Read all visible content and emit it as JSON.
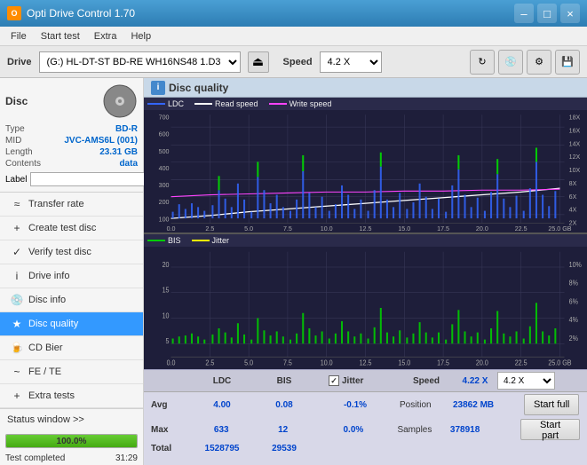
{
  "titleBar": {
    "title": "Opti Drive Control 1.70",
    "minimize": "–",
    "maximize": "□",
    "close": "×"
  },
  "menuBar": {
    "items": [
      "File",
      "Start test",
      "Extra",
      "Help"
    ]
  },
  "driveBar": {
    "label": "Drive",
    "driveValue": "(G:)  HL-DT-ST BD-RE  WH16NS48 1.D3",
    "speedLabel": "Speed",
    "speedValue": "4.2 X"
  },
  "disc": {
    "title": "Disc",
    "type": {
      "label": "Type",
      "value": "BD-R"
    },
    "mid": {
      "label": "MID",
      "value": "JVC-AMS6L (001)"
    },
    "length": {
      "label": "Length",
      "value": "23.31 GB"
    },
    "contents": {
      "label": "Contents",
      "value": "data"
    },
    "labelField": {
      "label": "Label",
      "placeholder": ""
    }
  },
  "nav": {
    "items": [
      {
        "id": "transfer-rate",
        "label": "Transfer rate",
        "icon": "≈"
      },
      {
        "id": "create-test-disc",
        "label": "Create test disc",
        "icon": "+"
      },
      {
        "id": "verify-test-disc",
        "label": "Verify test disc",
        "icon": "✓"
      },
      {
        "id": "drive-info",
        "label": "Drive info",
        "icon": "i"
      },
      {
        "id": "disc-info",
        "label": "Disc info",
        "icon": "📀"
      },
      {
        "id": "disc-quality",
        "label": "Disc quality",
        "icon": "★",
        "active": true
      },
      {
        "id": "cd-bier",
        "label": "CD Bier",
        "icon": "🍺"
      },
      {
        "id": "fe-te",
        "label": "FE / TE",
        "icon": "~"
      },
      {
        "id": "extra-tests",
        "label": "Extra tests",
        "icon": "+"
      }
    ]
  },
  "statusWindow": {
    "label": "Status window >>",
    "progressPercent": "100.0%",
    "progressWidth": 100,
    "completedText": "Test completed",
    "time": "31:29"
  },
  "discQuality": {
    "title": "Disc quality",
    "iconLabel": "i",
    "chart1": {
      "legend": [
        {
          "label": "LDC",
          "color": "#3366ff"
        },
        {
          "label": "Read speed",
          "color": "#ffffff"
        },
        {
          "label": "Write speed",
          "color": "#ff44ff"
        }
      ],
      "yAxisLeft": [
        "700",
        "600",
        "500",
        "400",
        "300",
        "200",
        "100"
      ],
      "yAxisRight": [
        "18X",
        "16X",
        "14X",
        "12X",
        "10X",
        "8X",
        "6X",
        "4X",
        "2X"
      ],
      "xAxis": [
        "0.0",
        "2.5",
        "5.0",
        "7.5",
        "10.0",
        "12.5",
        "15.0",
        "17.5",
        "20.0",
        "22.5",
        "25.0 GB"
      ]
    },
    "chart2": {
      "legend": [
        {
          "label": "BIS",
          "color": "#00cc00"
        },
        {
          "label": "Jitter",
          "color": "#ffff00"
        }
      ],
      "yAxisLeft": [
        "20",
        "15",
        "10",
        "5"
      ],
      "yAxisRight": [
        "10%",
        "8%",
        "6%",
        "4%",
        "2%"
      ],
      "xAxis": [
        "0.0",
        "2.5",
        "5.0",
        "7.5",
        "10.0",
        "12.5",
        "15.0",
        "17.5",
        "20.0",
        "22.5",
        "25.0 GB"
      ]
    },
    "stats": {
      "headers": [
        "",
        "LDC",
        "BIS",
        "",
        "Jitter",
        "Speed",
        ""
      ],
      "avg": {
        "label": "Avg",
        "ldc": "4.00",
        "bis": "0.08",
        "jitter": "-0.1%"
      },
      "max": {
        "label": "Max",
        "ldc": "633",
        "bis": "12",
        "jitter": "0.0%"
      },
      "total": {
        "label": "Total",
        "ldc": "1528795",
        "bis": "29539"
      },
      "speed": {
        "label": "Speed",
        "value": "4.22 X"
      },
      "speedSelect": "4.2 X",
      "position": {
        "label": "Position",
        "value": "23862 MB"
      },
      "samples": {
        "label": "Samples",
        "value": "378918"
      },
      "jitterChecked": true,
      "startFull": "Start full",
      "startPart": "Start part"
    }
  }
}
